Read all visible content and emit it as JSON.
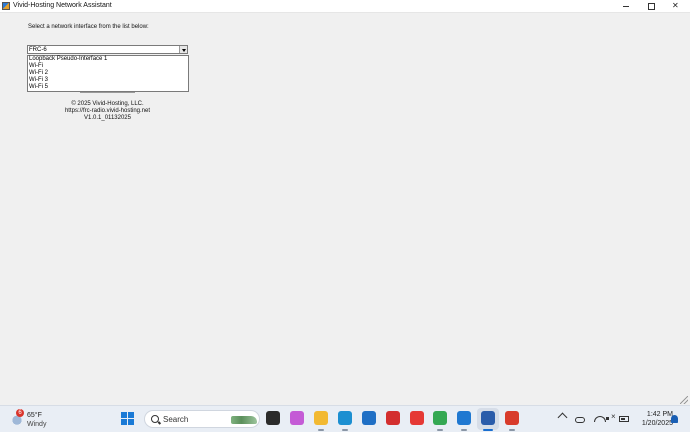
{
  "window": {
    "title": "Vivid-Hosting Network Assistant"
  },
  "prompt": "Select a network interface from the list below:",
  "combo": {
    "value": "FRC-6",
    "options": [
      "Loopback Pseudo-Interface 1",
      "Wi-Fi",
      "Wi-Fi 2",
      "Wi-Fi 3",
      "Wi-Fi 5"
    ]
  },
  "footer": {
    "copyright": "© 2025 Vivid-Hosting, LLC.",
    "url": "https://frc-radio.vivid-hosting.net",
    "version": "V1.0.1_01132025"
  },
  "taskbar": {
    "weather": {
      "temp": "65°F",
      "condition": "Windy",
      "badge": "6"
    },
    "search_label": "Search",
    "icons": [
      {
        "name": "task-view-icon",
        "color": "#2b2b2b"
      },
      {
        "name": "copilot-icon",
        "color": "#c45bd6"
      },
      {
        "name": "file-explorer-icon",
        "color": "#f2b932"
      },
      {
        "name": "edge-icon",
        "color": "#1c8fd1"
      },
      {
        "name": "microsoft-store-icon",
        "color": "#1f6fc5"
      },
      {
        "name": "lastpass-icon",
        "color": "#d32f2f"
      },
      {
        "name": "ni-app-icon",
        "color": "#e53935"
      },
      {
        "name": "chrome-icon",
        "color": "#34a853"
      },
      {
        "name": "vscode-icon",
        "color": "#1f78d1"
      },
      {
        "name": "powershell-icon",
        "color": "#2a5caa"
      },
      {
        "name": "network-assistant-icon",
        "color": "#d83b2b"
      }
    ],
    "clock": {
      "time": "1:42 PM",
      "date": "1/20/2025"
    }
  }
}
